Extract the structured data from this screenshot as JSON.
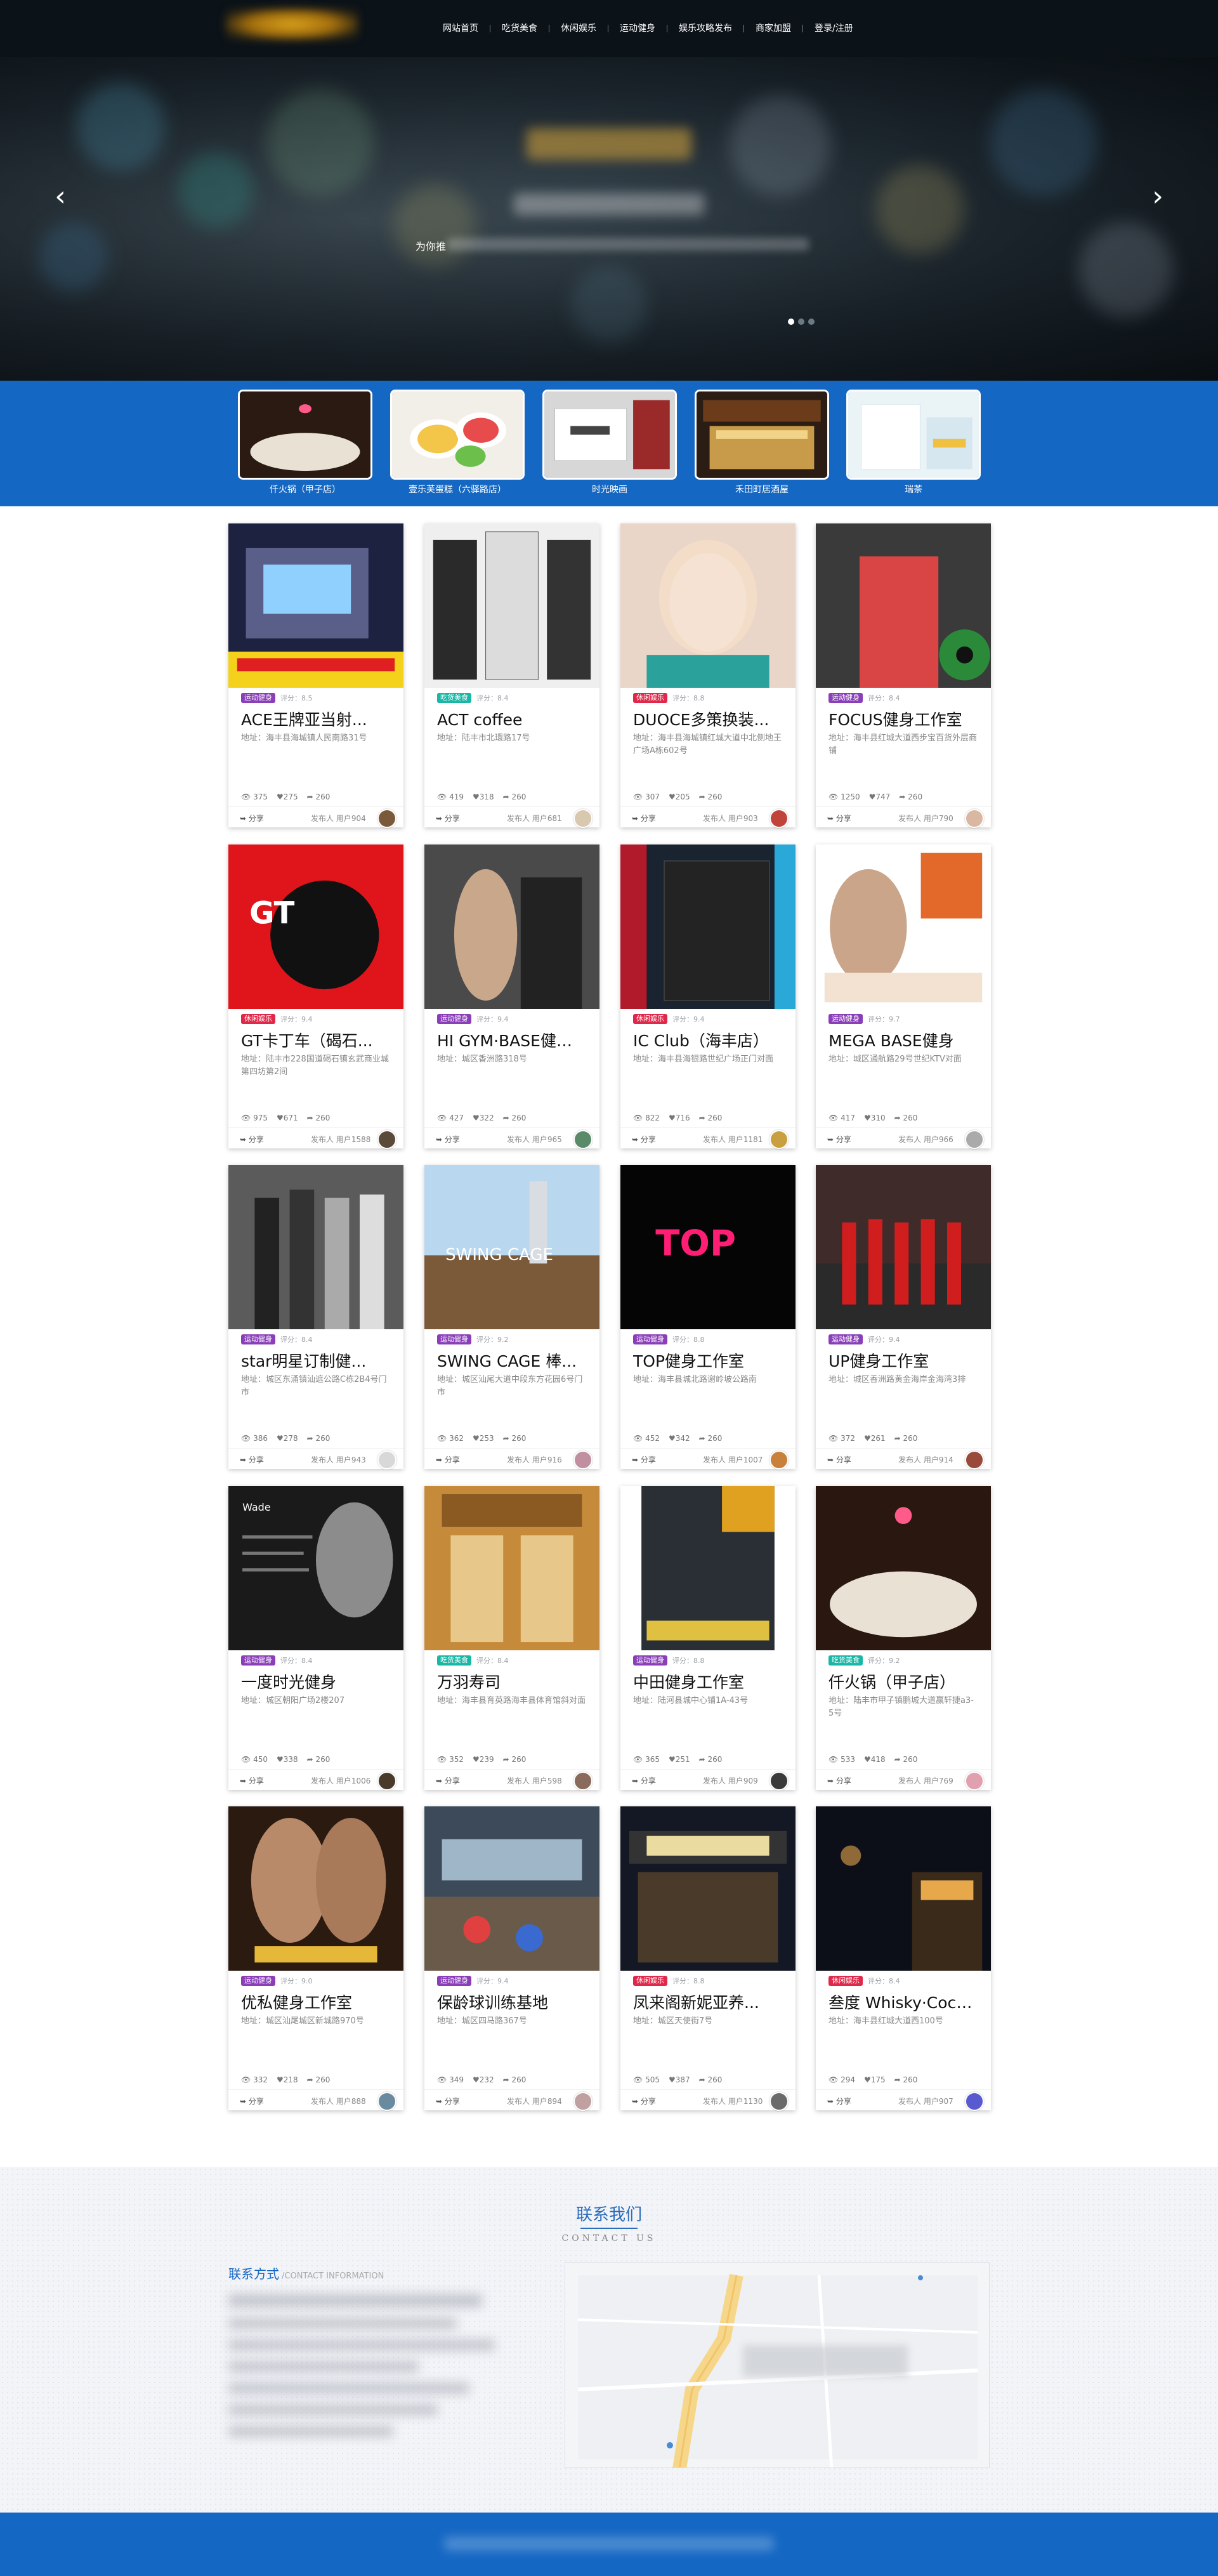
{
  "nav": {
    "items": [
      "网站首页",
      "吃货美食",
      "休闲娱乐",
      "运动健身",
      "娱乐攻略发布",
      "商家加盟",
      "登录/注册"
    ]
  },
  "hero": {
    "line": "为你推"
  },
  "featured": [
    {
      "label": "仟火锅（甲子店）",
      "icon": "hotpot-photo"
    },
    {
      "label": "壹乐芙蛋糕（六驿路店）",
      "icon": "cake-photo"
    },
    {
      "label": "时光映画",
      "icon": "studio-photo"
    },
    {
      "label": "禾田町居酒屋",
      "icon": "izakaya-photo"
    },
    {
      "label": "瑞茶",
      "icon": "tea-shop-photo"
    }
  ],
  "tag_colors": {
    "运动健身": "#8a3fb8",
    "吃货美食": "#19b7a6",
    "休闲娱乐": "#e0294a"
  },
  "cards": [
    {
      "title": "ACE王牌亚当射...",
      "tag": "运动健身",
      "score": "评分：8.5",
      "address": "地址：海丰县海城镇人民南路31号",
      "views": "375",
      "likes": "275",
      "shares": "260",
      "publisher": "发布人 用户904"
    },
    {
      "title": "ACT coffee",
      "tag": "吃货美食",
      "score": "评分：8.4",
      "address": "地址：陆丰市北環路17号",
      "views": "419",
      "likes": "318",
      "shares": "260",
      "publisher": "发布人 用户681"
    },
    {
      "title": "DUOCE多策换装...",
      "tag": "休闲娱乐",
      "score": "评分：8.8",
      "address": "地址：海丰县海城镇红城大道中北侧地王广场A栋602号",
      "views": "307",
      "likes": "205",
      "shares": "260",
      "publisher": "发布人 用户903"
    },
    {
      "title": "FOCUS健身工作室",
      "tag": "运动健身",
      "score": "评分：8.4",
      "address": "地址：海丰县红城大道西步宝百货外层商铺",
      "views": "1250",
      "likes": "747",
      "shares": "260",
      "publisher": "发布人 用户790"
    },
    {
      "title": "GT卡丁车（碣石...",
      "tag": "休闲娱乐",
      "score": "评分：9.4",
      "address": "地址：陆丰市228国道碣石镇玄武商业城第四坊第2间",
      "views": "975",
      "likes": "671",
      "shares": "260",
      "publisher": "发布人 用户1588"
    },
    {
      "title": "HI GYM·BASE健身...",
      "tag": "运动健身",
      "score": "评分：9.4",
      "address": "地址：城区香洲路318号",
      "views": "427",
      "likes": "322",
      "shares": "260",
      "publisher": "发布人 用户965"
    },
    {
      "title": "IC Club（海丰店）",
      "tag": "休闲娱乐",
      "score": "评分：9.4",
      "address": "地址：海丰县海银路世纪广场正门对面",
      "views": "822",
      "likes": "716",
      "shares": "260",
      "publisher": "发布人 用户1181"
    },
    {
      "title": "MEGA BASE健身",
      "tag": "运动健身",
      "score": "评分：9.7",
      "address": "地址：城区通航路29号世纪KTV对面",
      "views": "417",
      "likes": "310",
      "shares": "260",
      "publisher": "发布人 用户966"
    },
    {
      "title": "star明星订制健...",
      "tag": "运动健身",
      "score": "评分：8.4",
      "address": "地址：城区东涌镇汕遮公路C栋2B4号门市",
      "views": "386",
      "likes": "278",
      "shares": "260",
      "publisher": "发布人 用户943"
    },
    {
      "title": "SWING CAGE 棒...",
      "tag": "运动健身",
      "score": "评分：9.2",
      "address": "地址：城区汕尾大道中段东方花园6号门市",
      "views": "362",
      "likes": "253",
      "shares": "260",
      "publisher": "发布人 用户916"
    },
    {
      "title": "TOP健身工作室",
      "tag": "运动健身",
      "score": "评分：8.8",
      "address": "地址：海丰县城北路谢岭坡公路南",
      "views": "452",
      "likes": "342",
      "shares": "260",
      "publisher": "发布人 用户1007"
    },
    {
      "title": "UP健身工作室",
      "tag": "运动健身",
      "score": "评分：9.4",
      "address": "地址：城区香洲路黄金海岸金海湾3排",
      "views": "372",
      "likes": "261",
      "shares": "260",
      "publisher": "发布人 用户914"
    },
    {
      "title": "一度时光健身",
      "tag": "运动健身",
      "score": "评分：8.4",
      "address": "地址：城区朝阳广场2楼207",
      "views": "450",
      "likes": "338",
      "shares": "260",
      "publisher": "发布人 用户1006"
    },
    {
      "title": "万羽寿司",
      "tag": "吃货美食",
      "score": "评分：8.4",
      "address": "地址：海丰县育英路海丰县体育馆斜对面",
      "views": "352",
      "likes": "239",
      "shares": "260",
      "publisher": "发布人 用户598"
    },
    {
      "title": "中田健身工作室",
      "tag": "运动健身",
      "score": "评分：8.8",
      "address": "地址：陆河县城中心铺1A-43号",
      "views": "365",
      "likes": "251",
      "shares": "260",
      "publisher": "发布人 用户909"
    },
    {
      "title": "仟火锅（甲子店）",
      "tag": "吃货美食",
      "score": "评分：9.2",
      "address": "地址：陆丰市甲子镇鹏城大道赢轩捷a3-5号",
      "views": "533",
      "likes": "418",
      "shares": "260",
      "publisher": "发布人 用户769"
    },
    {
      "title": "优私健身工作室",
      "tag": "运动健身",
      "score": "评分：9.0",
      "address": "地址：城区汕尾城区新城路970号",
      "views": "332",
      "likes": "218",
      "shares": "260",
      "publisher": "发布人 用户888"
    },
    {
      "title": "保龄球训练基地",
      "tag": "运动健身",
      "score": "评分：9.4",
      "address": "地址：城区四马路367号",
      "views": "349",
      "likes": "232",
      "shares": "260",
      "publisher": "发布人 用户894"
    },
    {
      "title": "凤来阁新妮亚养...",
      "tag": "休闲娱乐",
      "score": "评分：8.8",
      "address": "地址：城区天使街7号",
      "views": "505",
      "likes": "387",
      "shares": "260",
      "publisher": "发布人 用户1130"
    },
    {
      "title": "叁度 Whisky·Cock...",
      "tag": "休闲娱乐",
      "score": "评分：8.4",
      "address": "地址：海丰县红城大道西100号",
      "views": "294",
      "likes": "175",
      "shares": "260",
      "publisher": "发布人 用户907"
    }
  ],
  "card_labels": {
    "share": "分享"
  },
  "contact": {
    "title": "联系我们",
    "subtitle": "CONTACT US",
    "info_title": "联系方式",
    "info_title_en": "/CONTACT INFORMATION"
  }
}
